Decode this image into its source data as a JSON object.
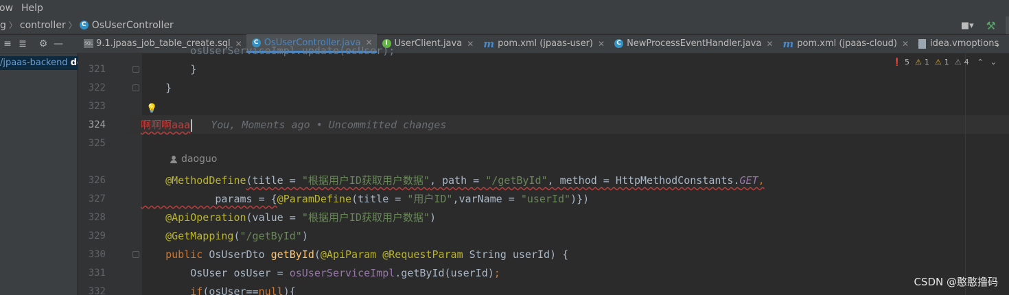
{
  "menu": {
    "items": [
      "ow",
      "Help"
    ]
  },
  "breadcrumb": {
    "items": [
      "g",
      "controller",
      "OsUserController"
    ]
  },
  "tabs": [
    {
      "label": "9.1.jpaas_job_table_create.sql",
      "icon": "sql-file-icon",
      "closable": true,
      "active": false
    },
    {
      "label": "OsUserController.java",
      "icon": "class-icon",
      "closable": true,
      "active": true
    },
    {
      "label": "UserClient.java",
      "icon": "interface-icon",
      "closable": true,
      "active": false
    },
    {
      "label": "pom.xml (jpaas-user)",
      "icon": "maven-icon",
      "closable": true,
      "active": false
    },
    {
      "label": "NewProcessEventHandler.java",
      "icon": "class-icon",
      "closable": true,
      "active": false
    },
    {
      "label": "pom.xml (jpaas-cloud)",
      "icon": "maven-icon",
      "closable": true,
      "active": false
    },
    {
      "label": "idea.vmoptions",
      "icon": "file-icon",
      "closable": true,
      "active": false
    }
  ],
  "project": {
    "path": "/jpaas-backend",
    "bold": "de"
  },
  "inspection": {
    "errors": "5",
    "warn1": "1",
    "warn2": "1",
    "weak": "4"
  },
  "editor": {
    "lines": {
      "l321": "321",
      "l322": "322",
      "l323": "323",
      "l324": "324",
      "l325": "325",
      "l326": "326",
      "l327": "327",
      "l328": "328",
      "l329": "329",
      "l330": "330",
      "l331": "331",
      "l332": "332"
    },
    "typed_text": "啊啊啊aaa",
    "blame_hint": "You, Moments ago • Uncommitted changes",
    "author": "daoguo"
  },
  "watermark": "CSDN @憨憨撸码",
  "colors": {
    "accent": "#4a88c7",
    "error": "#bc3f3c",
    "keyword": "#cc7832",
    "annotation": "#bbb529",
    "string": "#6a8759"
  }
}
